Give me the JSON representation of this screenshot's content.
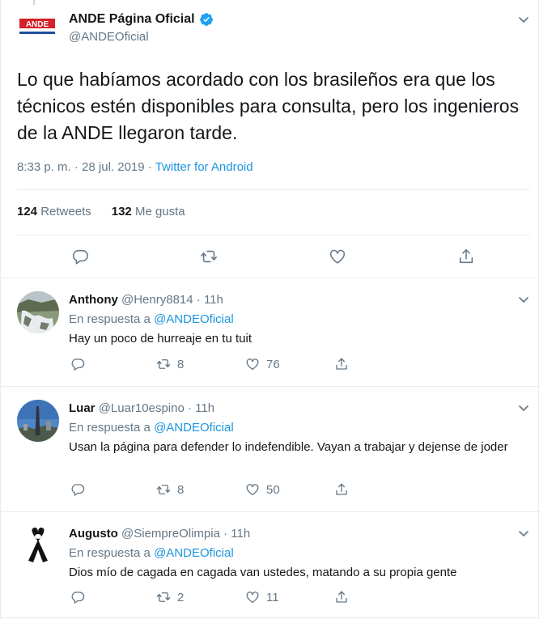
{
  "tweet": {
    "author_name": "ANDE Página Oficial",
    "handle": "@ANDEOficial",
    "logo_text": "ANDE",
    "text": "Lo que habíamos acordado con los brasileños era que los técnicos estén disponibles para consulta,  pero los ingenieros de la ANDE llegaron tarde.",
    "time": "8:33 p. m.",
    "date": "28 jul. 2019",
    "separator": "·",
    "source": "Twitter for Android",
    "retweets_count": "124",
    "retweets_label": "Retweets",
    "likes_count": "132",
    "likes_label": "Me gusta"
  },
  "replies": [
    {
      "name": "Anthony",
      "handle": "@Henry8814",
      "time": "11h",
      "in_reply_label": "En respuesta a",
      "mention": "@ANDEOficial",
      "text": "Hay un poco de hurreaje en tu tuit",
      "retweets": "8",
      "likes": "76"
    },
    {
      "name": "Luar",
      "handle": "@Luar10espino",
      "time": "11h",
      "in_reply_label": "En respuesta a",
      "mention": "@ANDEOficial",
      "text": "Usan la página para defender lo indefendible. Vayan a trabajar y dejense de joder",
      "retweets": "8",
      "likes": "50"
    },
    {
      "name": "Augusto",
      "handle": "@SiempreOlimpia",
      "time": "11h",
      "in_reply_label": "En respuesta a",
      "mention": "@ANDEOficial",
      "text": "Dios mío de cagada en cagada van ustedes, matando a su propia gente",
      "retweets": "2",
      "likes": "11"
    }
  ],
  "colors": {
    "link": "#1b95e0",
    "secondary": "#657786",
    "brand_red": "#d6202a"
  },
  "icons": [
    "chevron-down-icon",
    "verified-badge-icon",
    "reply-icon",
    "retweet-icon",
    "like-icon",
    "share-icon"
  ]
}
